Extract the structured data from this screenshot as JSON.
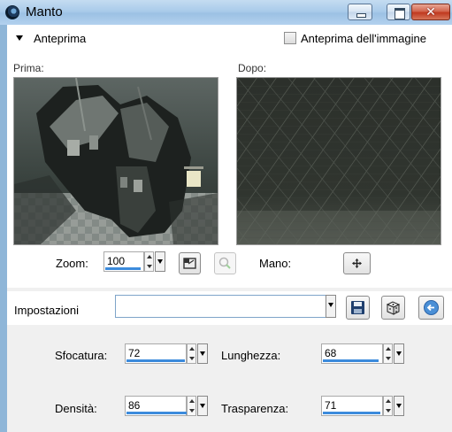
{
  "window": {
    "title": "Manto",
    "minimize_icon": "minimize-icon",
    "maximize_icon": "maximize-icon",
    "close_icon": "close-icon",
    "close_glyph": "✕"
  },
  "preview": {
    "heading": "Anteprima",
    "toggle_label": "Anteprima dell'immagine",
    "toggle_checked": false,
    "before_label": "Prima:",
    "after_label": "Dopo:",
    "zoom_label": "Zoom:",
    "zoom_value": "100",
    "pan_label": "Mano:"
  },
  "settings": {
    "label": "Impostazioni",
    "preset_value": "",
    "save_icon": "save-icon",
    "randomize_icon": "dice-icon",
    "reset_icon": "reset-icon"
  },
  "params": {
    "blur": {
      "label": "Sfocatura:",
      "value": "72",
      "level": 0.72
    },
    "length": {
      "label": "Lunghezza:",
      "value": "68",
      "level": 0.68
    },
    "density": {
      "label": "Densità:",
      "value": "86",
      "level": 0.86
    },
    "transparency": {
      "label": "Trasparenza:",
      "value": "71",
      "level": 0.71
    }
  },
  "colors": {
    "accent": "#3c8bdc",
    "titlebar": "#aacbea",
    "close_button": "#c0391f"
  }
}
